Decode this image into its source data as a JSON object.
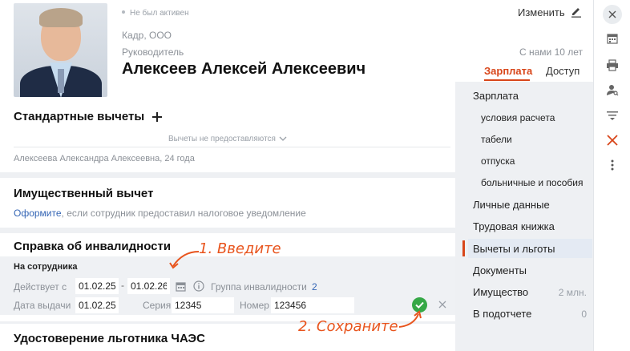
{
  "header": {
    "status": "Не был активен",
    "edit_label": "Изменить",
    "company": "Кадр, ООО",
    "position": "Руководитель",
    "tenure": "С нами 10 лет",
    "full_name": "Алексеев Алексей Алексеевич",
    "tabs": [
      {
        "label": "Зарплата",
        "active": true
      },
      {
        "label": "Доступ",
        "active": false
      }
    ]
  },
  "standard_deductions": {
    "title": "Стандартные вычеты",
    "collapsed_text": "Вычеты не предоставляются",
    "person": "Алексеева Александра Алексеевна, 24 года"
  },
  "property_deduction": {
    "title": "Имущественный вычет",
    "link": "Оформите",
    "text": ", если сотрудник предоставил налоговое уведомление"
  },
  "disability": {
    "title": "Справка об инвалидности",
    "subtitle": "На сотрудника",
    "valid_from_label": "Действует с",
    "valid_from": "01.02.25",
    "valid_to": "01.02.26",
    "group_label": "Группа инвалидности",
    "group_value": "2",
    "issue_date_label": "Дата выдачи",
    "issue_date": "01.02.25",
    "series_label": "Серия",
    "series": "12345",
    "number_label": "Номер",
    "number": "123456"
  },
  "chaes": {
    "title": "Удостоверение льготника ЧАЭС"
  },
  "annotations": {
    "step1": "1. Введите",
    "step2": "2. Сохраните",
    "color": "#e8541d"
  },
  "nav": {
    "items": [
      {
        "label": "Зарплата",
        "sub": false
      },
      {
        "label": "условия расчета",
        "sub": true
      },
      {
        "label": "табели",
        "sub": true
      },
      {
        "label": "отпуска",
        "sub": true
      },
      {
        "label": "больничные и пособия",
        "sub": true
      },
      {
        "label": "Личные данные",
        "sub": false
      },
      {
        "label": "Трудовая книжка",
        "sub": false
      },
      {
        "label": "Вычеты и льготы",
        "sub": false,
        "active": true
      },
      {
        "label": "Документы",
        "sub": false
      },
      {
        "label": "Имущество",
        "sub": false,
        "count": "2 млн."
      },
      {
        "label": "В подотчете",
        "sub": false,
        "count": "0"
      }
    ]
  },
  "toolbar": {
    "icons": [
      "close-icon",
      "calendar-icon",
      "printer-icon",
      "user-search-icon",
      "filter-list-icon",
      "dismiss-red-icon",
      "more-icon"
    ]
  },
  "colors": {
    "accent": "#d8461a",
    "link": "#3566b5",
    "success": "#35a846"
  }
}
